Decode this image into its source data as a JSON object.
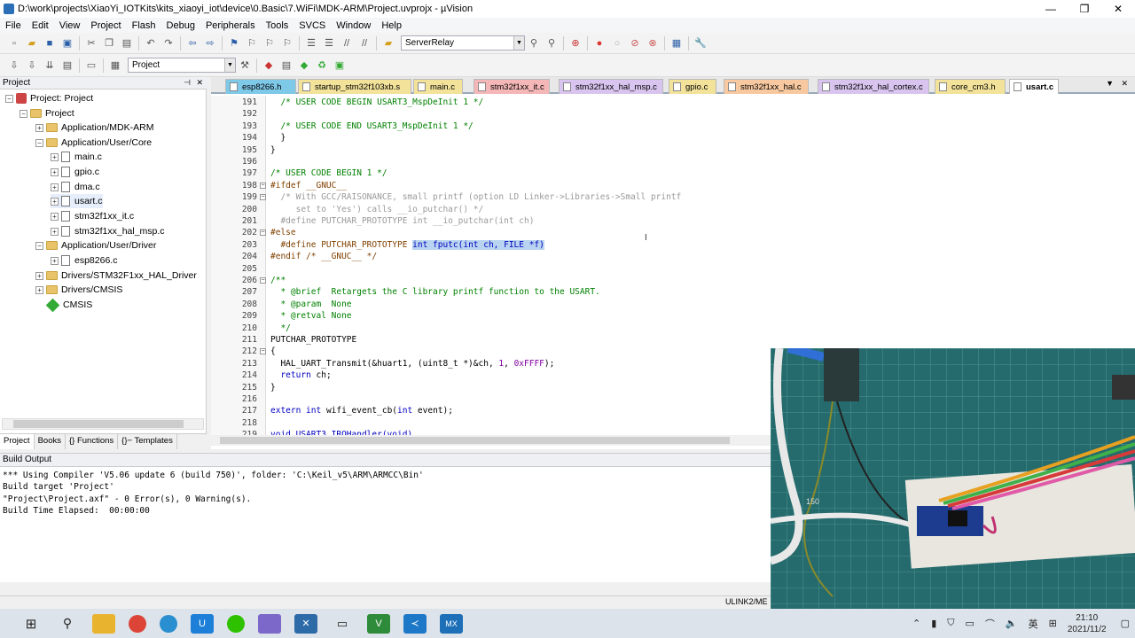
{
  "window": {
    "title": "D:\\work\\projects\\XiaoYi_IOTKits\\kits_xiaoyi_iot\\device\\0.Basic\\7.WiFi\\MDK-ARM\\Project.uvprojx - µVision",
    "buttons": [
      "—",
      "❐",
      "✕"
    ]
  },
  "menu": [
    "File",
    "Edit",
    "View",
    "Project",
    "Flash",
    "Debug",
    "Peripherals",
    "Tools",
    "SVCS",
    "Window",
    "Help"
  ],
  "toolbar1": {
    "target_combo": "ServerRelay"
  },
  "toolbar2": {
    "project_combo": "Project"
  },
  "project_panel": {
    "header": "Project",
    "tree": [
      {
        "label": "Project: Project",
        "kind": "project"
      },
      {
        "label": "Project",
        "kind": "folder"
      },
      {
        "label": "Application/MDK-ARM",
        "kind": "folder"
      },
      {
        "label": "Application/User/Core",
        "kind": "folder"
      },
      {
        "label": "main.c",
        "kind": "file"
      },
      {
        "label": "gpio.c",
        "kind": "file"
      },
      {
        "label": "dma.c",
        "kind": "file"
      },
      {
        "label": "usart.c",
        "kind": "file"
      },
      {
        "label": "stm32f1xx_it.c",
        "kind": "file"
      },
      {
        "label": "stm32f1xx_hal_msp.c",
        "kind": "file"
      },
      {
        "label": "Application/User/Driver",
        "kind": "folder"
      },
      {
        "label": "esp8266.c",
        "kind": "file"
      },
      {
        "label": "Drivers/STM32F1xx_HAL_Driver",
        "kind": "folder"
      },
      {
        "label": "Drivers/CMSIS",
        "kind": "folder"
      },
      {
        "label": "CMSIS",
        "kind": "gem"
      }
    ],
    "tabs": [
      "Project",
      "Books",
      "{} Functions",
      "{}− Templates"
    ]
  },
  "editor": {
    "tabs": [
      {
        "label": "esp8266.h",
        "color": "#7ec8e8"
      },
      {
        "label": "startup_stm32f103xb.s",
        "color": "#f2e29a"
      },
      {
        "label": "main.c",
        "color": "#f2e29a"
      },
      {
        "label": "stm32f1xx_it.c",
        "color": "#f4b6b6"
      },
      {
        "label": "stm32f1xx_hal_msp.c",
        "color": "#d8c4ee"
      },
      {
        "label": "gpio.c",
        "color": "#f2e29a"
      },
      {
        "label": "stm32f1xx_hal.c",
        "color": "#f8c9a0"
      },
      {
        "label": "stm32f1xx_hal_cortex.c",
        "color": "#d8c4ee"
      },
      {
        "label": "core_cm3.h",
        "color": "#f2e29a"
      },
      {
        "label": "usart.c",
        "color": "#f8f0b0"
      }
    ],
    "lines": [
      {
        "n": "191",
        "t": "  /* USER CODE BEGIN USART3_MspDeInit 1 */",
        "c": "cm"
      },
      {
        "n": "192",
        "t": "",
        "c": ""
      },
      {
        "n": "193",
        "t": "  /* USER CODE END USART3_MspDeInit 1 */",
        "c": "cm"
      },
      {
        "n": "194",
        "t": "  }",
        "c": ""
      },
      {
        "n": "195",
        "t": "}",
        "c": ""
      },
      {
        "n": "196",
        "t": "",
        "c": ""
      },
      {
        "n": "197",
        "t": "/* USER CODE BEGIN 1 */",
        "c": "cm"
      },
      {
        "n": "198",
        "t": "#ifdef __GNUC__",
        "c": "pp"
      },
      {
        "n": "199",
        "t": "  /* With GCC/RAISONANCE, small printf (option LD Linker->Libraries->Small printf",
        "c": "dim"
      },
      {
        "n": "200",
        "t": "     set to 'Yes') calls __io_putchar() */",
        "c": "dim"
      },
      {
        "n": "201",
        "t": "  #define PUTCHAR_PROTOTYPE int __io_putchar(int ch)",
        "c": "dim"
      },
      {
        "n": "202",
        "t": "#else",
        "c": "pp"
      },
      {
        "n": "203",
        "t": "",
        "c": "special"
      },
      {
        "n": "204",
        "t": "#endif /* __GNUC__ */",
        "c": "pp"
      },
      {
        "n": "205",
        "t": "",
        "c": ""
      },
      {
        "n": "206",
        "t": "/**",
        "c": "cm"
      },
      {
        "n": "207",
        "t": "  * @brief  Retargets the C library printf function to the USART.",
        "c": "cm"
      },
      {
        "n": "208",
        "t": "  * @param  None",
        "c": "cm"
      },
      {
        "n": "209",
        "t": "  * @retval None",
        "c": "cm"
      },
      {
        "n": "210",
        "t": "  */",
        "c": "cm"
      },
      {
        "n": "211",
        "t": "PUTCHAR_PROTOTYPE",
        "c": ""
      },
      {
        "n": "212",
        "t": "{",
        "c": ""
      },
      {
        "n": "213",
        "t": "",
        "c": "special"
      },
      {
        "n": "214",
        "t": "",
        "c": "special"
      },
      {
        "n": "215",
        "t": "}",
        "c": ""
      },
      {
        "n": "216",
        "t": "",
        "c": ""
      },
      {
        "n": "217",
        "t": "",
        "c": "special"
      },
      {
        "n": "218",
        "t": "",
        "c": ""
      },
      {
        "n": "219",
        "t": "void USART3_IRQHandler(void)",
        "c": "kw"
      }
    ],
    "line203": {
      "pre": "  #define PUTCHAR_PROTOTYPE ",
      "sel": "int fputc(int ch, FILE *f)"
    },
    "line213": {
      "a": "  HAL_UART_Transmit(&huart1, (uint8_t *)&ch, ",
      "b": "1",
      "c": ", ",
      "d": "0xFFFF",
      "e": ");"
    },
    "line214": {
      "a": "  ",
      "b": "return",
      "c": " ch;"
    },
    "line217": {
      "a": "extern ",
      "b": "int",
      "c": " wifi_event_cb(",
      "d": "int",
      "e": " event);"
    }
  },
  "build_output": {
    "header": "Build Output",
    "lines": [
      "*** Using Compiler 'V5.06 update 6 (build 750)', folder: 'C:\\Keil_v5\\ARM\\ARMCC\\Bin'",
      "Build target 'Project'",
      "\"Project\\Project.axf\" - 0 Error(s), 0 Warning(s).",
      "Build Time Elapsed:  00:00:00"
    ]
  },
  "status": {
    "debugger": "ULINK2/ME"
  },
  "taskbar": {
    "apps": [
      "windows-icon",
      "search-icon",
      "explorer-icon",
      "chrome-icon",
      "edge-icon",
      "app-u-icon",
      "wechat-icon",
      "files-icon",
      "app-x-icon",
      "camera-icon",
      "keil-icon",
      "vscode-icon",
      "mx-icon"
    ],
    "time": "21:10",
    "date": "2021/11/2",
    "ime": "英"
  },
  "video": {
    "label": "150"
  }
}
